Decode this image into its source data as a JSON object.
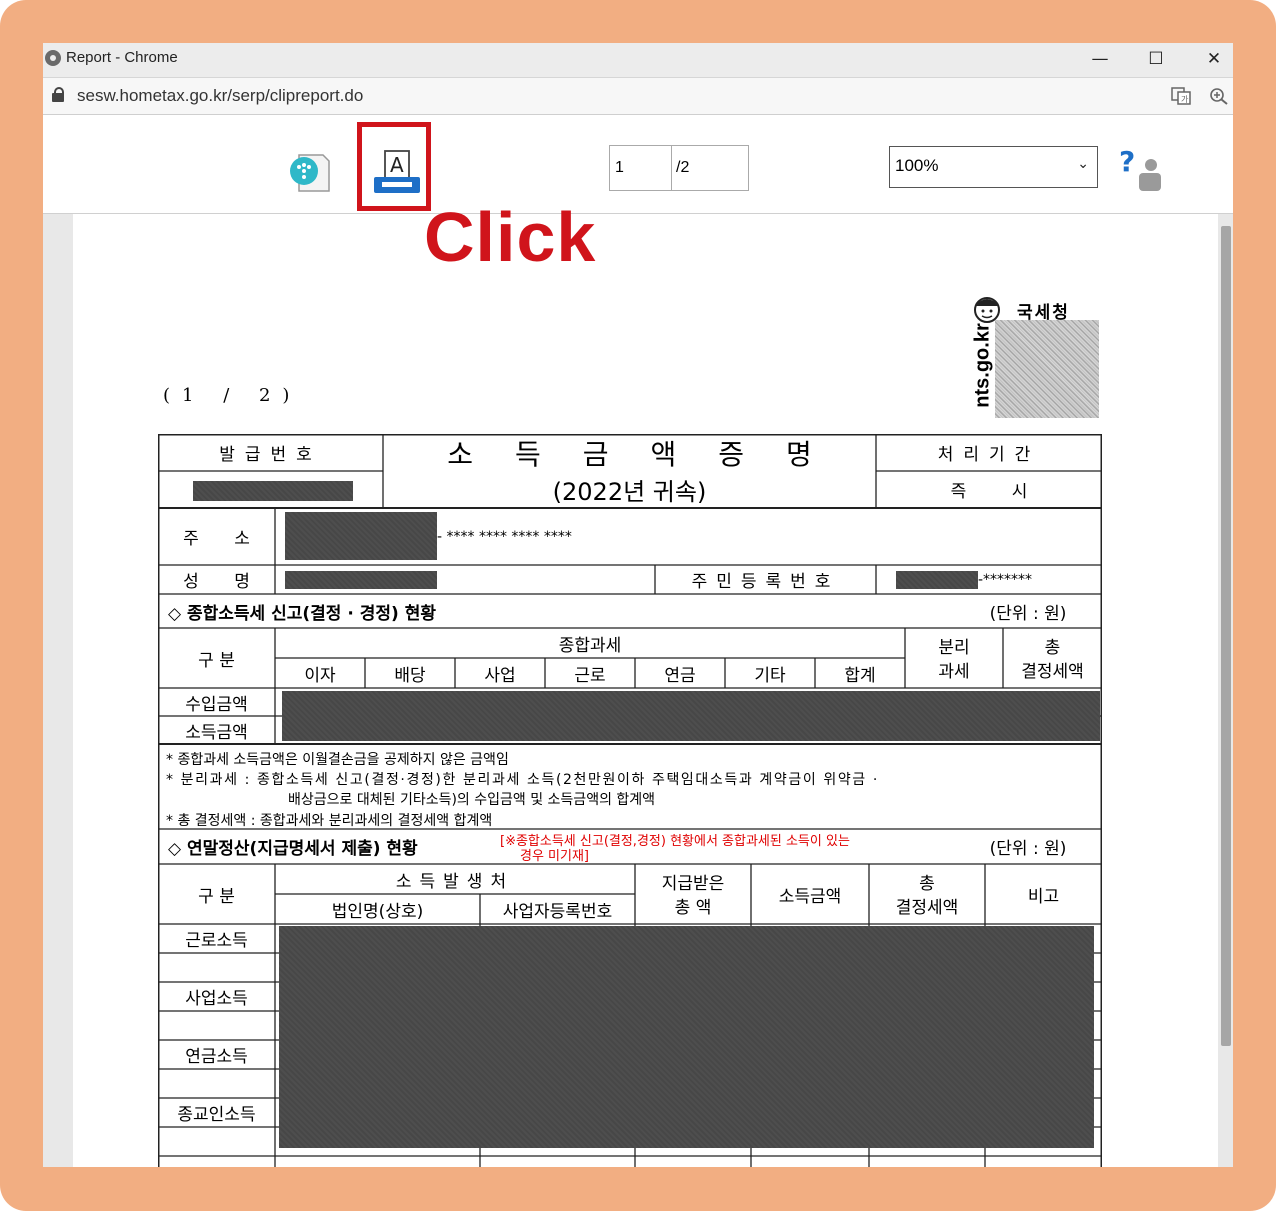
{
  "window": {
    "title": "Report - Chrome",
    "url": "sesw.hometax.go.kr/serp/clipreport.do",
    "min_glyph": "—",
    "max_glyph": "☐",
    "close_glyph": "✕"
  },
  "toolbar": {
    "page_current": "1",
    "page_total": "/2",
    "zoom": "100%",
    "first_glyph": "|<",
    "prev_glyph": "<",
    "next_glyph": ">",
    "last_glyph": ">|",
    "close_glyph": "✕",
    "help_glyph": "?",
    "printer_letter": "A"
  },
  "annotation": {
    "click_label": "Click",
    "color": "#d0141b"
  },
  "logo": {
    "org_name": "국세청",
    "site": "nts.go.kr"
  },
  "document": {
    "page_indicator": "(1 / 2)",
    "issue_no_label": "발급번호",
    "title": "소득금액증명",
    "year": "(2022년 귀속)",
    "period_label": "처리기간",
    "period_value": "즉 시",
    "address_label": "주 소",
    "address_masked": "- **** **** **** ****",
    "name_label": "성 명",
    "rrn_label": "주민등록번호",
    "rrn_masked": "-*******",
    "section1_title": "◇ 종합소득세 신고(결정 · 경정) 현황",
    "unit": "(단위 : 원)",
    "col_gubun": "구 분",
    "col_general": "종합과세",
    "subcols": [
      "이자",
      "배당",
      "사업",
      "근로",
      "연금",
      "기타",
      "합계"
    ],
    "col_separate": [
      "분리",
      "과세"
    ],
    "col_total_tax": [
      "총",
      "결정세액"
    ],
    "row_income": "수입금액",
    "row_earned": "소득금액",
    "notes": [
      "* 종합과세 소득금액은 이월결손금을 공제하지 않은 금액임",
      "* 분리과세 : 종합소득세 신고(결정·경정)한 분리과세 소득(2천만원이하 주택임대소득과 계약금이 위약금 ·",
      "배상금으로 대체된 기타소득)의 수입금액 및 소득금액의 합계액",
      "* 총 결정세액 : 종합과세와 분리과세의 결정세액 합계액"
    ],
    "section2_title": "◇ 연말정산(지급명세서 제출) 현황",
    "section2_note": [
      "[※종합소득세 신고(결정,경정) 현황에서 종합과세된 소득이 있는",
      "경우 미기재]"
    ],
    "col_source": "소득발생처",
    "col_corp": "법인명(상호)",
    "col_bizno": "사업자등록번호",
    "col_paid": [
      "지급받은",
      "총 액"
    ],
    "col_income_amt": "소득금액",
    "col_remark": "비고",
    "rows2": [
      "근로소득",
      "사업소득",
      "연금소득",
      "종교인소득"
    ]
  }
}
